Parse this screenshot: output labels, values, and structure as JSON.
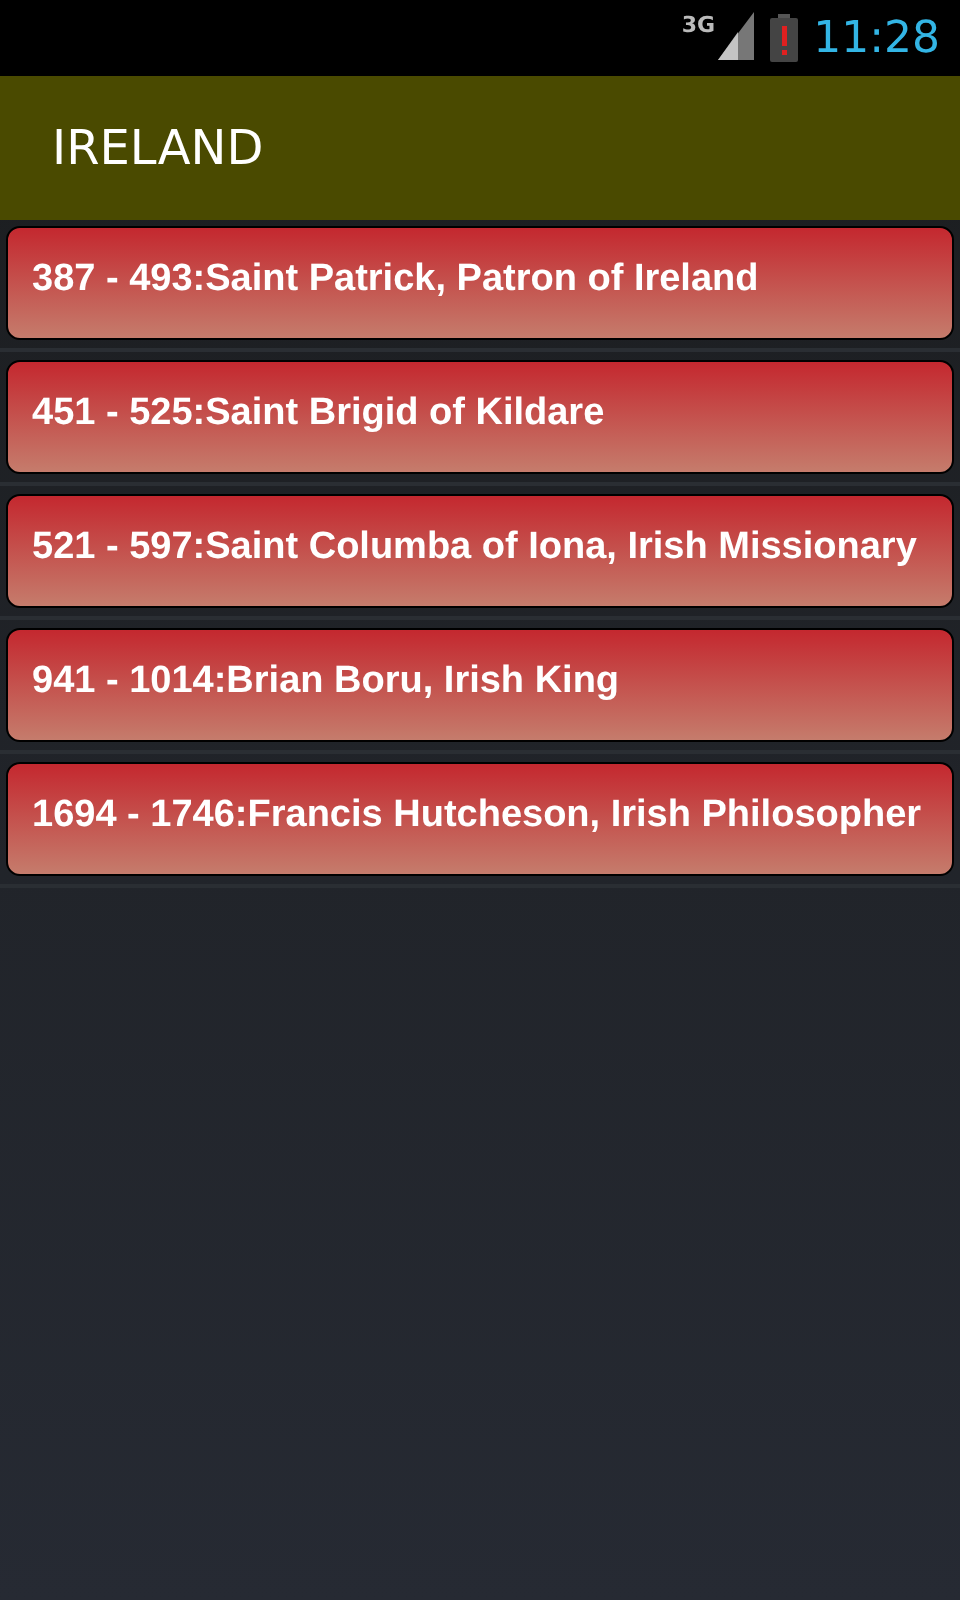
{
  "status_bar": {
    "network": "3G",
    "time": "11:28"
  },
  "action_bar": {
    "title": "IRELAND"
  },
  "items": [
    {
      "text": "387 - 493:Saint Patrick, Patron of Ireland"
    },
    {
      "text": "451 - 525:Saint Brigid of Kildare"
    },
    {
      "text": "521 - 597:Saint Columba of Iona, Irish Missionary"
    },
    {
      "text": "941 - 1014:Brian Boru, Irish King"
    },
    {
      "text": "1694 - 1746:Francis Hutcheson, Irish Philosopher"
    }
  ]
}
